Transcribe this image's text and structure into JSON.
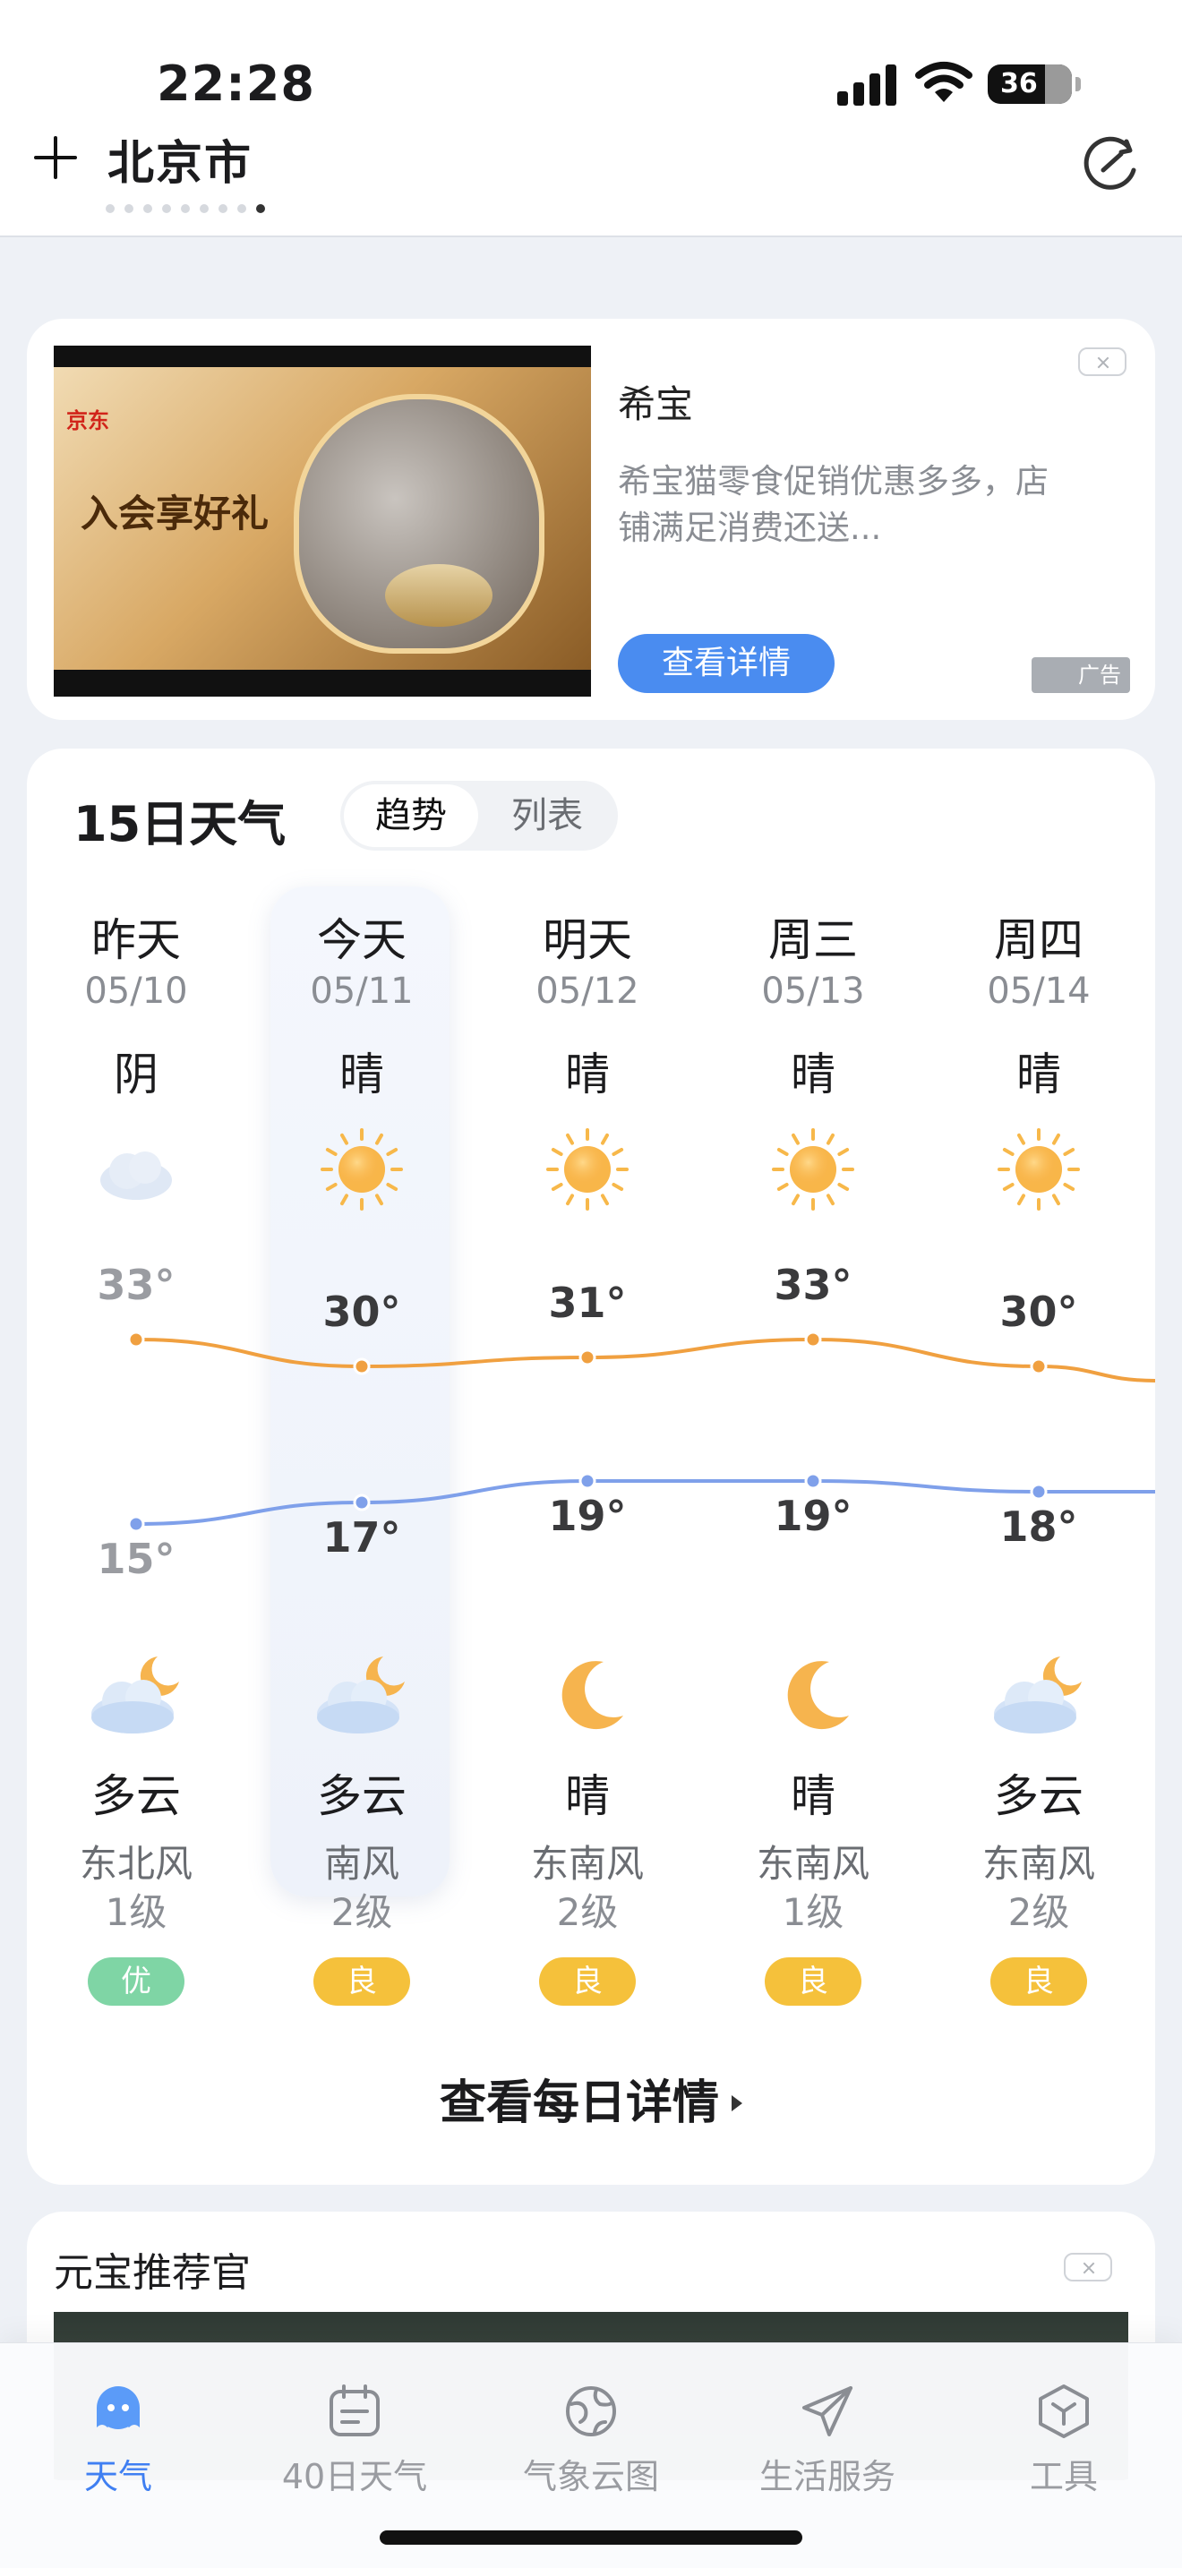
{
  "status_bar": {
    "time": "22:28",
    "battery": "36"
  },
  "header": {
    "city": "北京市",
    "page_dots_count": 9,
    "active_dot_index": 8
  },
  "ad": {
    "image_text": {
      "brand": "京东",
      "slogan": "入会享好礼"
    },
    "title": "希宝",
    "description": "希宝猫零食促销优惠多多，店铺满足消费还送...",
    "button_label": "查看详情",
    "tag": "广告"
  },
  "forecast": {
    "title": "15日天气",
    "view_options": [
      "趋势",
      "列表"
    ],
    "selected_view": "趋势",
    "days": [
      {
        "day": "昨天",
        "date": "05/10",
        "day_condition": "阴",
        "day_icon": "cloud-icon",
        "high": "33°",
        "low": "15°",
        "night_icon": "partly-cloudy-night-icon",
        "night_condition": "多云",
        "wind": "东北风",
        "wind_level": "1级",
        "aqi": "优",
        "aqi_color": "#7fd5a5"
      },
      {
        "day": "今天",
        "date": "05/11",
        "day_condition": "晴",
        "day_icon": "sun-icon",
        "high": "30°",
        "low": "17°",
        "night_icon": "partly-cloudy-night-icon",
        "night_condition": "多云",
        "wind": "南风",
        "wind_level": "2级",
        "aqi": "良",
        "aqi_color": "#f5c13b"
      },
      {
        "day": "明天",
        "date": "05/12",
        "day_condition": "晴",
        "day_icon": "sun-icon",
        "high": "31°",
        "low": "19°",
        "night_icon": "moon-icon",
        "night_condition": "晴",
        "wind": "东南风",
        "wind_level": "2级",
        "aqi": "良",
        "aqi_color": "#f5c13b"
      },
      {
        "day": "周三",
        "date": "05/13",
        "day_condition": "晴",
        "day_icon": "sun-icon",
        "high": "33°",
        "low": "19°",
        "night_icon": "moon-icon",
        "night_condition": "晴",
        "wind": "东南风",
        "wind_level": "1级",
        "aqi": "良",
        "aqi_color": "#f5c13b"
      },
      {
        "day": "周四",
        "date": "05/14",
        "day_condition": "晴",
        "day_icon": "sun-icon",
        "high": "30°",
        "low": "18°",
        "night_icon": "partly-cloudy-night-icon",
        "night_condition": "多云",
        "wind": "东南风",
        "wind_level": "2级",
        "aqi": "良",
        "aqi_color": "#f5c13b"
      }
    ],
    "details_link": "查看每日详情",
    "high_line_color": "#f0a040",
    "low_line_color": "#7fa0ea"
  },
  "recommendation": {
    "title": "元宝推荐官"
  },
  "tabbar": {
    "active": "天气",
    "tabs": [
      {
        "label": "天气",
        "icon": "ghost-weather-icon"
      },
      {
        "label": "40日天气",
        "icon": "calendar-icon"
      },
      {
        "label": "气象云图",
        "icon": "globe-icon"
      },
      {
        "label": "生活服务",
        "icon": "paper-plane-icon"
      },
      {
        "label": "工具",
        "icon": "cube-icon"
      }
    ]
  },
  "colors": {
    "accent": "#3f7ff2",
    "background": "#eef1f6"
  }
}
